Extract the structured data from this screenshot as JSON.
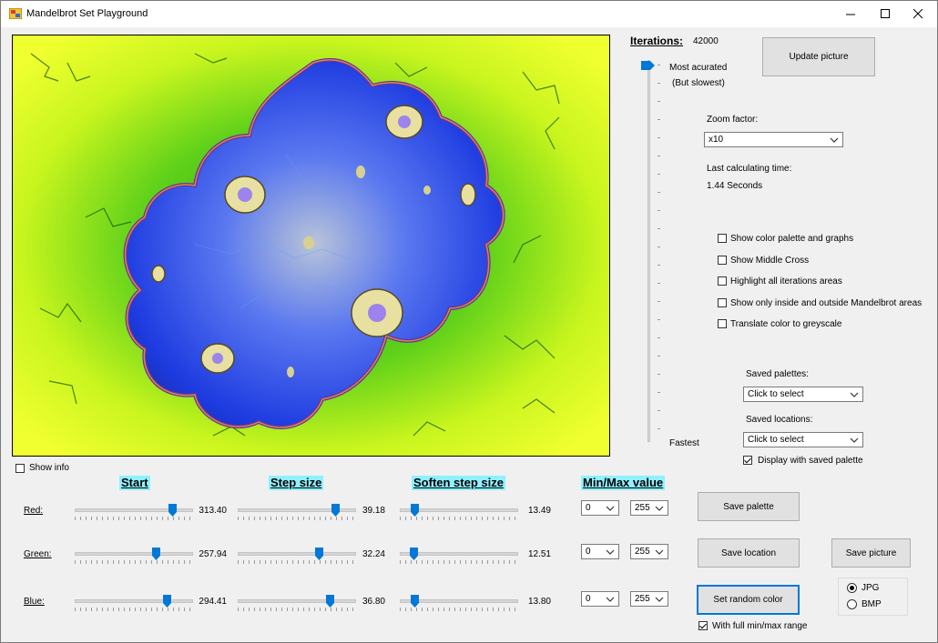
{
  "window": {
    "title": "Mandelbrot Set Playground",
    "minimize_icon": "minimize-icon",
    "maximize_icon": "maximize-icon",
    "close_icon": "close-icon"
  },
  "show_info": {
    "label": "Show info",
    "checked": false
  },
  "iterations": {
    "label": "Iterations:",
    "value": "42000",
    "slider_top_label": "Most acurated",
    "slider_top_sub": "(But slowest)",
    "slider_bottom_label": "Fastest"
  },
  "update_button": "Update picture",
  "zoom": {
    "label": "Zoom factor:",
    "selected": "x10"
  },
  "last_time": {
    "label": "Last calculating time:",
    "value": "1.44 Seconds"
  },
  "options": [
    {
      "label": "Show color palette and graphs",
      "checked": false
    },
    {
      "label": "Show Middle Cross",
      "checked": false
    },
    {
      "label": "Highlight all iterations areas",
      "checked": false
    },
    {
      "label": "Show only inside and outside Mandelbrot areas",
      "checked": false
    },
    {
      "label": "Translate color to greyscale",
      "checked": false
    }
  ],
  "saved_palettes": {
    "label": "Saved palettes:",
    "selected": "Click to select"
  },
  "saved_locations": {
    "label": "Saved locations:",
    "selected": "Click to select"
  },
  "display_saved_palette": {
    "label": "Display with saved palette",
    "checked": true
  },
  "headers": {
    "start": "Start",
    "step": "Step size",
    "soften": "Soften step size",
    "minmax": "Min/Max value"
  },
  "channels": [
    {
      "name": "Red:",
      "start": "313.40",
      "step": "39.18",
      "soften": "13.49",
      "min": "0",
      "max": "255",
      "start_level": 0.85,
      "step_level": 0.85,
      "soften_level": 0.1
    },
    {
      "name": "Green:",
      "start": "257.94",
      "step": "32.24",
      "soften": "12.51",
      "min": "0",
      "max": "255",
      "start_level": 0.7,
      "step_level": 0.7,
      "soften_level": 0.09
    },
    {
      "name": "Blue:",
      "start": "294.41",
      "step": "36.80",
      "soften": "13.80",
      "min": "0",
      "max": "255",
      "start_level": 0.8,
      "step_level": 0.8,
      "soften_level": 0.1
    }
  ],
  "buttons": {
    "save_palette": "Save  palette",
    "save_location": "Save location",
    "save_picture": "Save picture",
    "random_color": "Set random color"
  },
  "full_range": {
    "label": "With full min/max range",
    "checked": true
  },
  "format": {
    "options": [
      "JPG",
      "BMP"
    ],
    "selected": "JPG"
  },
  "colors": {
    "accent": "#0078d7",
    "header_bg": "#8ff0ff",
    "fractal_inner": "#1a3ad8",
    "fractal_outer": "#e8ff2a"
  }
}
